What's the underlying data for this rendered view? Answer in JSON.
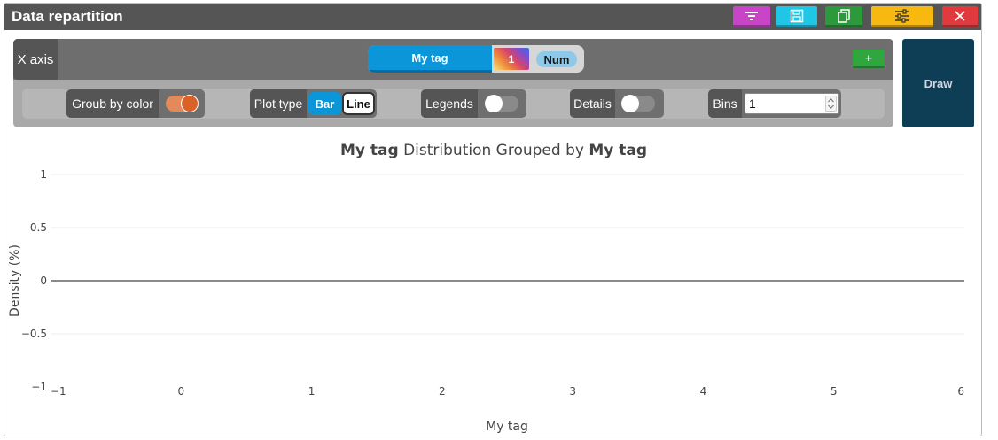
{
  "window": {
    "title": "Data repartition",
    "buttons": [
      {
        "name": "filter-button",
        "icon": "filter-icon",
        "color": "#c945c7"
      },
      {
        "name": "save-button",
        "icon": "save-icon",
        "color": "#1fc6e6"
      },
      {
        "name": "copy-button",
        "icon": "copy-icon",
        "color": "#2a9a3a"
      },
      {
        "name": "settings-button",
        "icon": "sliders-icon",
        "color": "#f7b90f"
      },
      {
        "name": "close-button",
        "icon": "close-icon",
        "color": "#e03a3e"
      }
    ]
  },
  "x_axis": {
    "label": "X axis",
    "tag": "My tag",
    "color_value": "1",
    "type_badge": "Num",
    "add_label": "+"
  },
  "controls": {
    "group_by_color": {
      "label": "Groub by color",
      "on": true
    },
    "plot_type": {
      "label": "Plot type",
      "options": [
        "Bar",
        "Line"
      ],
      "selected": "Bar"
    },
    "legends": {
      "label": "Legends",
      "on": false
    },
    "details": {
      "label": "Details",
      "on": false
    },
    "bins": {
      "label": "Bins",
      "value": "1"
    },
    "draw_label": "Draw"
  },
  "chart_data": {
    "type": "bar",
    "title_parts": [
      {
        "text": "My tag",
        "bold": true
      },
      {
        "text": " Distribution Grouped by ",
        "bold": false
      },
      {
        "text": "My tag",
        "bold": true
      }
    ],
    "xlabel": "My tag",
    "ylabel": "Density (%)",
    "xlim": [
      -1,
      6
    ],
    "ylim": [
      -1,
      1
    ],
    "x_ticks": [
      "−1",
      "0",
      "1",
      "2",
      "3",
      "4",
      "5",
      "6"
    ],
    "y_ticks": [
      "1",
      "0.5",
      "0",
      "−0.5",
      "−1"
    ],
    "series": [],
    "grid": true
  }
}
